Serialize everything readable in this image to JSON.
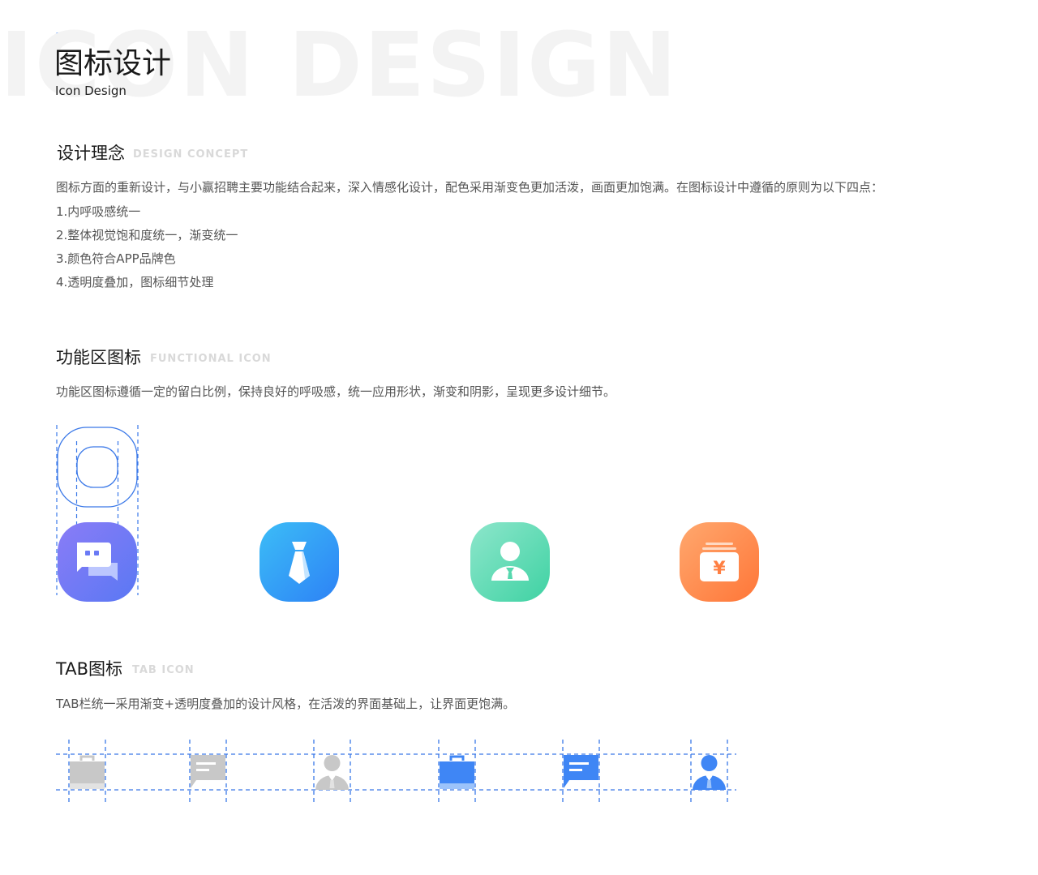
{
  "header": {
    "watermark": "ICON DESIGN",
    "title": "图标设计",
    "subtitle": "Icon Design"
  },
  "concept": {
    "title": "设计理念",
    "tag": "DESIGN CONCEPT",
    "intro": "图标方面的重新设计，与小赢招聘主要功能结合起来，深入情感化设计，配色采用渐变色更加活泼，画面更加饱满。在图标设计中遵循的原则为以下四点：",
    "points": [
      "1.内呼吸感统一",
      "2.整体视觉饱和度统一，渐变统一",
      "3.颜色符合APP品牌色",
      "4.透明度叠加，图标细节处理"
    ]
  },
  "functional": {
    "title": "功能区图标",
    "tag": "FUNCTIONAL ICON",
    "desc": "功能区图标遵循一定的留白比例，保持良好的呼吸感，统一应用形状，渐变和阴影，呈现更多设计细节。",
    "icons": [
      {
        "name": "chat-bubbles-icon",
        "from": "#8a7cf6",
        "to": "#5b7cf5"
      },
      {
        "name": "necktie-icon",
        "from": "#37b6f6",
        "to": "#2f86f6"
      },
      {
        "name": "person-icon",
        "from": "#86e3c6",
        "to": "#40d3a6"
      },
      {
        "name": "yuan-wallet-icon",
        "from": "#ffa169",
        "to": "#ff7a3c"
      }
    ],
    "currency_symbol": "¥"
  },
  "tab": {
    "title": "TAB图标",
    "tag": "TAB ICON",
    "desc": "TAB栏统一采用渐变+透明度叠加的设计风格，在活泼的界面基础上，让界面更饱满。",
    "icons": [
      {
        "name": "briefcase-icon",
        "state": "inactive"
      },
      {
        "name": "message-icon",
        "state": "inactive"
      },
      {
        "name": "person-icon",
        "state": "inactive"
      },
      {
        "name": "briefcase-icon",
        "state": "active"
      },
      {
        "name": "message-icon",
        "state": "active"
      },
      {
        "name": "person-icon",
        "state": "active"
      }
    ],
    "colors": {
      "inactive": "#c8c8c8",
      "inactive_light": "#e2e2e2",
      "active": "#3f86f5",
      "active_light": "#9cc3fa"
    }
  },
  "guide_color": "#3a78e8"
}
